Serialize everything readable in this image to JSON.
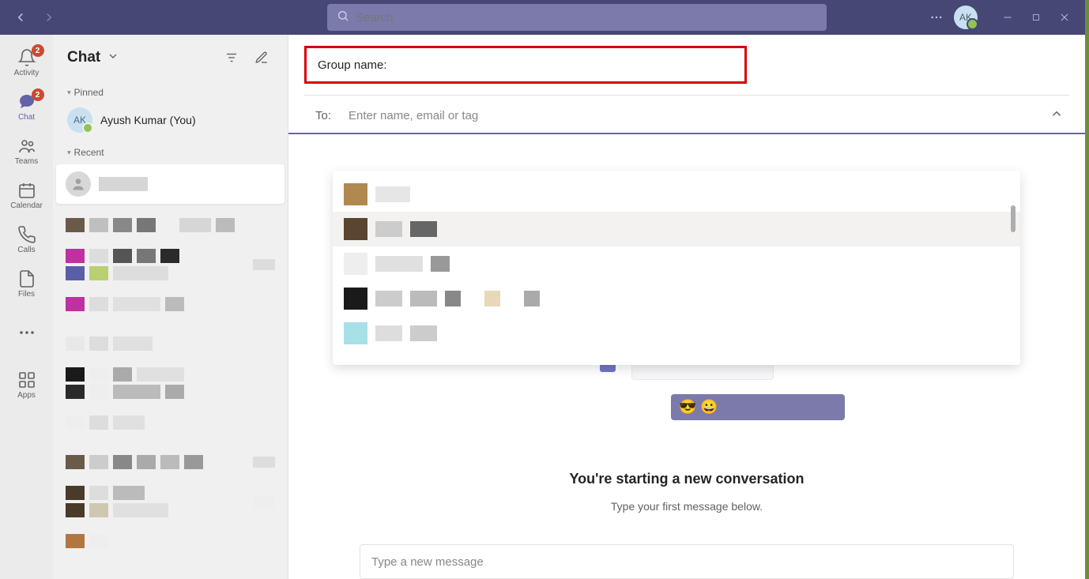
{
  "titlebar": {
    "search_placeholder": "Search",
    "avatar_initials": "AK"
  },
  "rail": {
    "items": [
      {
        "label": "Activity",
        "badge": "2"
      },
      {
        "label": "Chat",
        "badge": "2"
      },
      {
        "label": "Teams"
      },
      {
        "label": "Calendar"
      },
      {
        "label": "Calls"
      },
      {
        "label": "Files"
      }
    ],
    "apps_label": "Apps"
  },
  "chatlist": {
    "title": "Chat",
    "pinned_label": "Pinned",
    "pinned_user": {
      "initials": "AK",
      "name": "Ayush Kumar (You)"
    },
    "recent_label": "Recent"
  },
  "main": {
    "group_name_label": "Group name:",
    "to_label": "To:",
    "to_placeholder": "Enter name, email or tag",
    "nc_title": "You're starting a new conversation",
    "nc_sub": "Type your first message below.",
    "compose_placeholder": "Type a new message",
    "emoji": "😎 😀"
  }
}
